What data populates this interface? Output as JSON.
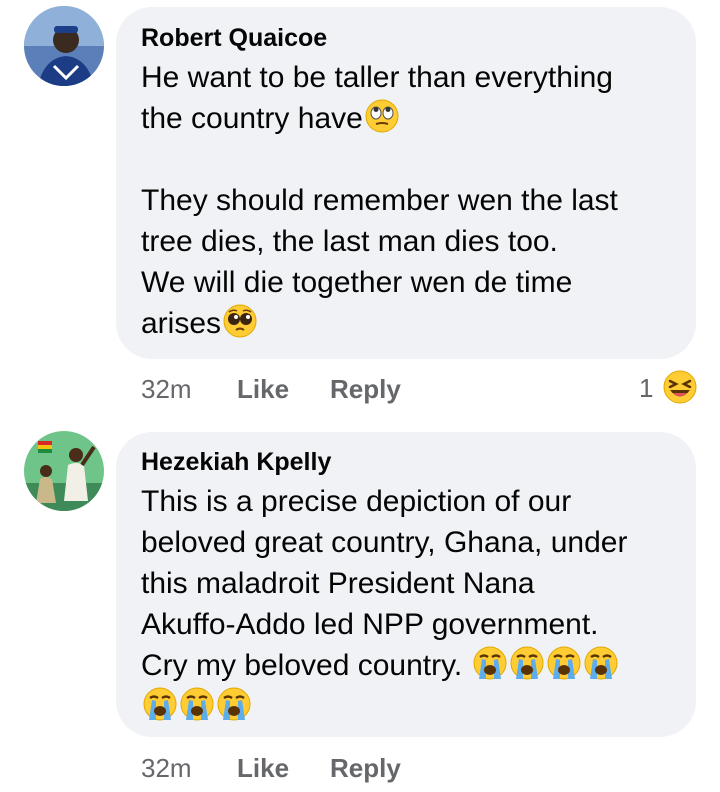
{
  "comments": [
    {
      "author": "Robert Quaicoe",
      "lines": [
        {
          "text": "He want to be taller than everything",
          "emoji": ""
        },
        {
          "text": "the country have",
          "emoji": "face-with-rolling-eyes-icon"
        },
        {
          "text": "",
          "emoji": ""
        },
        {
          "text": "They should remember wen the last",
          "emoji": ""
        },
        {
          "text": "tree dies, the last man dies too.",
          "emoji": ""
        },
        {
          "text": "We will die together wen de time",
          "emoji": ""
        },
        {
          "text": "arises",
          "emoji": "pleading-face-icon"
        }
      ],
      "time": "32m",
      "like_label": "Like",
      "reply_label": "Reply",
      "reaction_count": "1",
      "reaction_icon": "laughing-face-icon"
    },
    {
      "author": "Hezekiah Kpelly",
      "lines": [
        {
          "text": "This is a precise depiction of our"
        },
        {
          "text": "beloved great country, Ghana, under"
        },
        {
          "text": "this maladroit President Nana"
        },
        {
          "text": "Akuffo-Addo led NPP government."
        },
        {
          "text": "Cry my beloved country."
        }
      ],
      "emoji_row1": "loudly-crying-face-icon x4",
      "emoji_row2": "loudly-crying-face-icon x3",
      "time": "32m",
      "like_label": "Like",
      "reply_label": "Reply"
    }
  ],
  "colors": {
    "bubble": "#f0f2f5",
    "text": "#050505",
    "secondary": "#65676b"
  }
}
